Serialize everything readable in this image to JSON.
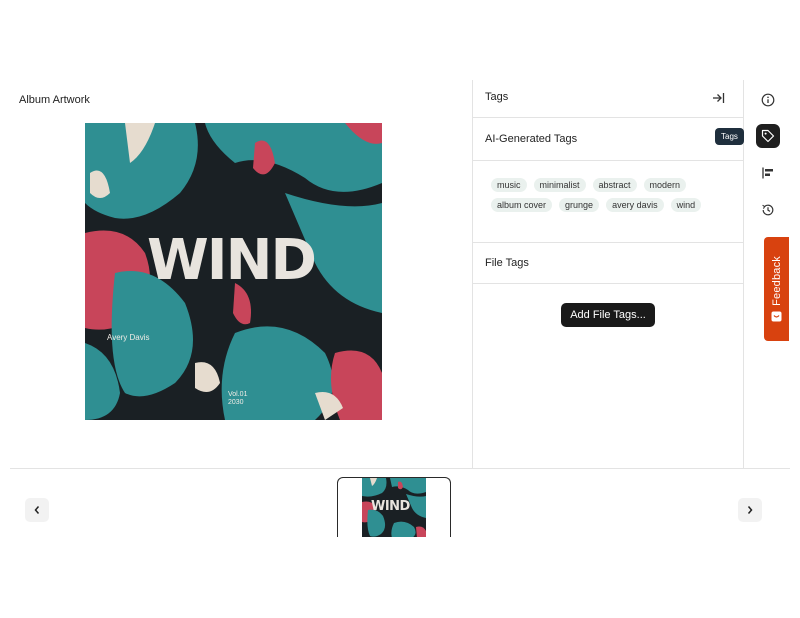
{
  "left_panel": {
    "title": "Album Artwork",
    "artwork": {
      "title": "WIND",
      "artist": "Avery Davis",
      "volume": "Vol.01",
      "year": "2030"
    }
  },
  "right_panel": {
    "header_title": "Tags",
    "collapse_icon": "collapse-right-icon",
    "ai_section_title": "AI-Generated Tags",
    "ai_tags": [
      "music",
      "minimalist",
      "abstract",
      "modern",
      "album cover",
      "grunge",
      "avery davis",
      "wind"
    ],
    "file_section_title": "File Tags",
    "add_file_tags_label": "Add File Tags..."
  },
  "icon_bar": {
    "items": [
      {
        "icon": "info-icon"
      },
      {
        "icon": "tag-icon",
        "active": true
      },
      {
        "icon": "align-left-icon"
      },
      {
        "icon": "history-icon"
      }
    ],
    "tooltip": "Tags"
  },
  "feedback": {
    "label": "Feedback"
  },
  "filmstrip": {
    "thumbnail_title": "WIND"
  },
  "colors": {
    "feedback_bg": "#d8420f",
    "tag_bg": "#eaf1ee",
    "button_dark": "#1a1a1a",
    "tooltip_bg": "#1f2f3d",
    "art_teal": "#2f8f92",
    "art_red": "#c8455a"
  }
}
